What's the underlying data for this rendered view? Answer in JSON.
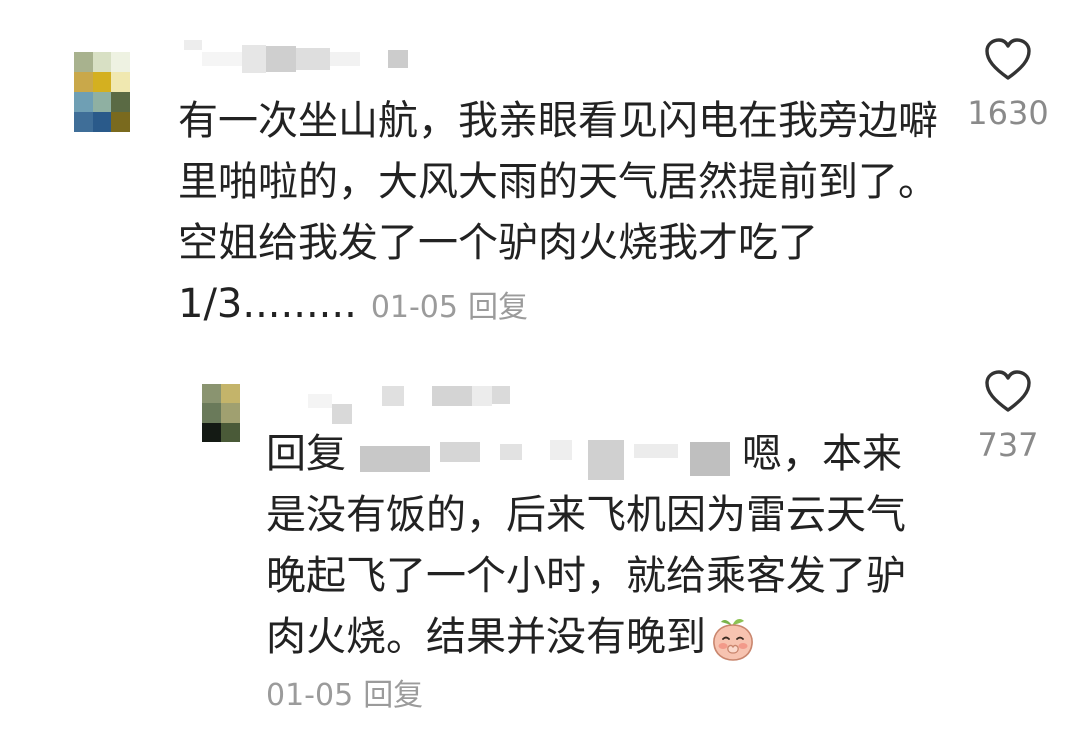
{
  "main_comment": {
    "avatar_pixels": [
      "#a8b28e",
      "#d8e0c4",
      "#eef2e2",
      "#c9a84a",
      "#d4b020",
      "#f0e8b0",
      "#6f9fb4",
      "#8fb0a2",
      "#5a6a44",
      "#3f6e98",
      "#2a5a8a",
      "#7a6a1e"
    ],
    "text_lines": [
      "有一次坐山航，我亲眼看见闪电在我旁边噼",
      "里啪啦的，大风大雨的天气居然提前到了。",
      "空姐给我发了一个驴肉火烧我才吃了"
    ],
    "last_line": "1/3.........",
    "date": "01-05",
    "reply_label": "回复",
    "like_count": "1630",
    "heart_icon": "heart-outline-icon"
  },
  "reply_comment": {
    "avatar_pixels": [
      "#8a9470",
      "#c4b46a",
      "#6a7a5a",
      "#a0a070",
      "#141a14",
      "#4a5a38"
    ],
    "prefix": "回复",
    "line1_rest": "嗯，本来",
    "text_lines": [
      "是没有饭的，后来飞机因为雷云天气",
      "晚起飞了一个小时，就给乘客发了驴"
    ],
    "last_line": "肉火烧。结果并没有晚到",
    "emoji": "peach-face-emoji",
    "date": "01-05",
    "reply_label": "回复",
    "like_count": "737",
    "heart_icon": "heart-outline-icon"
  }
}
